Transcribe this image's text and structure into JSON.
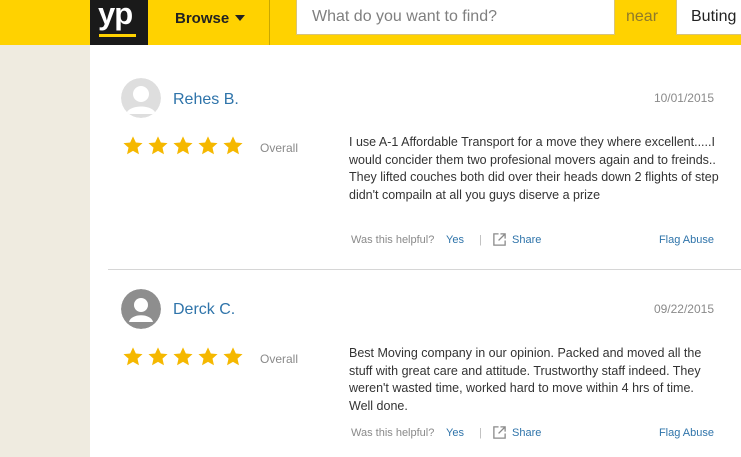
{
  "header": {
    "logo": "yp",
    "browse_label": "Browse",
    "search_placeholder": "What do you want to find?",
    "near_label": "near",
    "location_value": "Buting"
  },
  "reviews": [
    {
      "author": "Rehes B.",
      "date": "10/01/2015",
      "rating": 5,
      "rating_label": "Overall",
      "text": "I use A-1 Affordable Transport for a move they where excellent.....I would concider them two profesional movers again and to freinds.. They lifted couches both did over their heads down 2 flights of step didn't compailn at all you guys diserve a prize",
      "helpful_label": "Was this helpful?",
      "yes_label": "Yes",
      "share_label": "Share",
      "flag_label": "Flag Abuse",
      "avatar_tone": "light"
    },
    {
      "author": "Derck C.",
      "date": "09/22/2015",
      "rating": 5,
      "rating_label": "Overall",
      "text": "Best Moving company in our opinion. Packed and moved all the stuff with great care and attitude. Trustworthy staff indeed. They weren't wasted time, worked hard to move within 4 hrs of time. Well done.",
      "helpful_label": "Was this helpful?",
      "yes_label": "Yes",
      "share_label": "Share",
      "flag_label": "Flag Abuse",
      "avatar_tone": "dark"
    }
  ],
  "colors": {
    "brand_yellow": "#ffd200",
    "star": "#f5b800",
    "link": "#2f74aa"
  }
}
